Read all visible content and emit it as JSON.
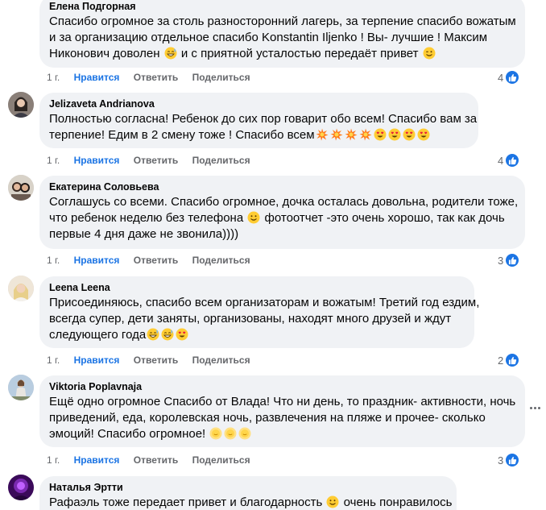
{
  "comments": [
    {
      "author": "Елена Подгорная",
      "lines": [
        "Спасибо огромное за столь разносторонний лагерь, за терпение спасибо вожатым",
        "и за организацию отдельное спасибо Konstantin Iljenko ! Вы- лучшие ! Максим",
        "Никонович доволен",
        "и с приятной усталостью передаёт привет"
      ],
      "time": "1 г.",
      "like": "Нравится",
      "reply": "Ответить",
      "share": "Поделиться",
      "reactions": "4"
    },
    {
      "author": "Jelizaveta Andrianova",
      "lines": [
        "Полностью согласна! Ребенок до сих пор говарит обо всем! Спасибо вам за",
        "терпение! Едим в 2 смену тоже ! Спасибо всем"
      ],
      "time": "1 г.",
      "like": "Нравится",
      "reply": "Ответить",
      "share": "Поделиться",
      "reactions": "4"
    },
    {
      "author": "Екатерина Соловьева",
      "lines": [
        "Соглашусь со всеми. Спасибо огромное, дочка осталась довольна, родители тоже,",
        "что ребенок неделю без телефона",
        "фотоотчет -это очень хорошо, так как дочь",
        "первые 4 дня даже не звонила))))"
      ],
      "time": "1 г.",
      "like": "Нравится",
      "reply": "Ответить",
      "share": "Поделиться",
      "reactions": "3"
    },
    {
      "author": "Leena Leena",
      "lines": [
        "Присоединяюсь, спасибо всем организаторам и вожатым! Третий год ездим,",
        "всегда супер, дети заняты, организованы, находят много друзей и ждут",
        "следующего года"
      ],
      "time": "1 г.",
      "like": "Нравится",
      "reply": "Ответить",
      "share": "Поделиться",
      "reactions": "2"
    },
    {
      "author": "Viktoria Poplavnaja",
      "lines": [
        "Ещё одно огромное Спасибо от Влада! Что ни день, то праздник- активности, ночь",
        "приведений, еда, королевская ночь, развлечения на пляже и прочее- сколько",
        "эмоций! Спасибо огромное!"
      ],
      "time": "1 г.",
      "like": "Нравится",
      "reply": "Ответить",
      "share": "Поделиться",
      "reactions": "3"
    },
    {
      "author": "Наталья Эртти",
      "lines": [
        "Рафаэль тоже передает привет и благодарность",
        "очень понравилось"
      ]
    }
  ],
  "colors": {
    "like_blue": "#1b74e4",
    "bubble_bg": "#f0f2f5",
    "meta_gray": "#65676b"
  },
  "icons": {
    "like_badge": "thumbs-up-icon",
    "more": "more-options-icon",
    "emoji_grin": "grinning-sweat-emoji",
    "emoji_wink": "winking-face-emoji",
    "emoji_collision": "collision-emoji",
    "emoji_heart_eyes": "heart-eyes-emoji",
    "emoji_smile": "smiling-face-emoji",
    "emoji_sun": "sun-emoji"
  }
}
